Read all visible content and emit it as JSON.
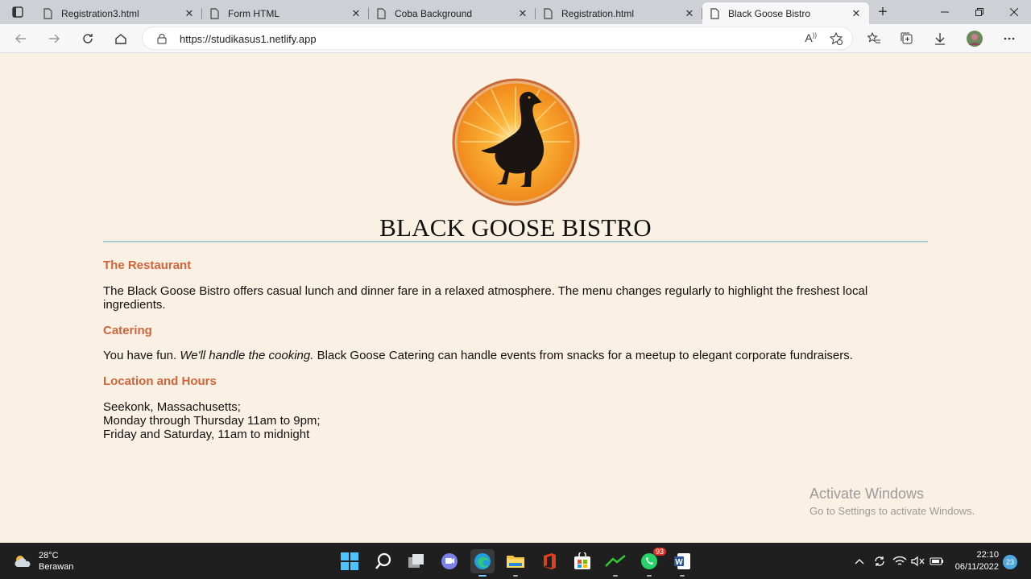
{
  "browser": {
    "tabs": [
      {
        "label": "Registration3.html",
        "active": false
      },
      {
        "label": "Form HTML",
        "active": false
      },
      {
        "label": "Coba Background",
        "active": false
      },
      {
        "label": "Registration.html",
        "active": false
      },
      {
        "label": "Black Goose Bistro",
        "active": true
      }
    ],
    "url": "https://studikasus1.netlify.app"
  },
  "page": {
    "title": "BLACK GOOSE BISTRO",
    "sections": [
      {
        "heading": "The Restaurant",
        "body": "The Black Goose Bistro offers casual lunch and dinner fare in a relaxed atmosphere. The menu changes regularly to highlight the freshest local ingredients."
      },
      {
        "heading": "Catering",
        "body_prefix": "You have fun. ",
        "body_em": "We'll handle the cooking.",
        "body_suffix": " Black Goose Catering can handle events from snacks for a meetup to elegant corporate fundraisers."
      },
      {
        "heading": "Location and Hours",
        "lines": [
          "Seekonk, Massachusetts;",
          "Monday through Thursday 11am to 9pm;",
          "Friday and Saturday, 11am to midnight"
        ]
      }
    ]
  },
  "watermark": {
    "line1": "Activate Windows",
    "line2": "Go to Settings to activate Windows."
  },
  "taskbar": {
    "temperature": "28°C",
    "weather": "Berawan",
    "whatsapp_badge": "93",
    "time": "22:10",
    "date": "06/11/2022",
    "notifications": "23"
  },
  "colors": {
    "heading": "#d0643a",
    "background": "#faf0e4",
    "rule": "#a9ccd1"
  }
}
